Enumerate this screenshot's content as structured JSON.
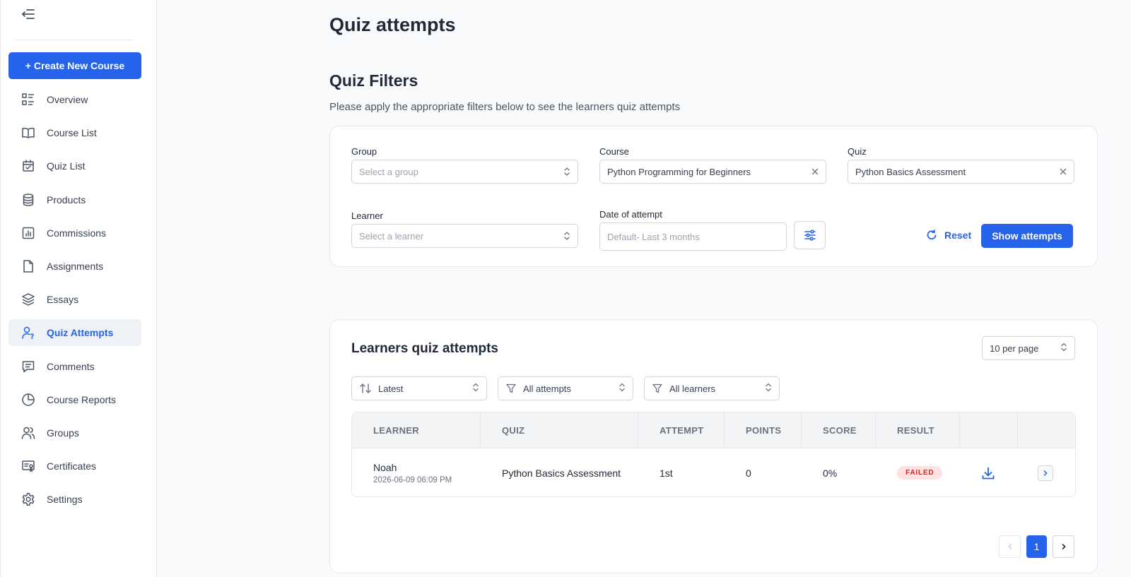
{
  "sidebar": {
    "create_label": "+ Create New Course",
    "items": [
      {
        "label": "Overview",
        "icon": "overview-icon",
        "active": false
      },
      {
        "label": "Course List",
        "icon": "book-icon",
        "active": false
      },
      {
        "label": "Quiz List",
        "icon": "calendar-check-icon",
        "active": false
      },
      {
        "label": "Products",
        "icon": "database-icon",
        "active": false
      },
      {
        "label": "Commissions",
        "icon": "bar-chart-icon",
        "active": false
      },
      {
        "label": "Assignments",
        "icon": "file-icon",
        "active": false
      },
      {
        "label": "Essays",
        "icon": "layers-icon",
        "active": false
      },
      {
        "label": "Quiz Attempts",
        "icon": "user-question-icon",
        "active": true
      },
      {
        "label": "Comments",
        "icon": "comment-icon",
        "active": false
      },
      {
        "label": "Course Reports",
        "icon": "pie-chart-icon",
        "active": false
      },
      {
        "label": "Groups",
        "icon": "users-icon",
        "active": false
      },
      {
        "label": "Certificates",
        "icon": "certificate-icon",
        "active": false
      },
      {
        "label": "Settings",
        "icon": "gear-icon",
        "active": false
      }
    ]
  },
  "page": {
    "title": "Quiz attempts"
  },
  "filters": {
    "title": "Quiz Filters",
    "subtitle": "Please apply the appropriate filters below to see the learners quiz attempts",
    "group_label": "Group",
    "group_placeholder": "Select a group",
    "course_label": "Course",
    "course_value": "Python Programming for Beginners",
    "quiz_label": "Quiz",
    "quiz_value": "Python Basics Assessment",
    "learner_label": "Learner",
    "learner_placeholder": "Select a learner",
    "date_label": "Date of attempt",
    "date_placeholder": "Default- Last 3 months",
    "reset_label": "Reset",
    "show_label": "Show attempts"
  },
  "results": {
    "title": "Learners quiz attempts",
    "per_page": "10 per page",
    "sort": "Latest",
    "attempt_filter": "All attempts",
    "learner_filter": "All learners",
    "columns": [
      "LEARNER",
      "QUIZ",
      "ATTEMPT",
      "POINTS",
      "SCORE",
      "RESULT"
    ],
    "rows": [
      {
        "learner": "Noah",
        "date": "2026-06-09 06:09 PM",
        "quiz": "Python Basics Assessment",
        "attempt": "1st",
        "points": "0",
        "score": "0%",
        "result": "FAILED"
      }
    ],
    "pagination": {
      "current": "1"
    }
  },
  "colors": {
    "accent": "#2563eb",
    "failed": "#dc2626",
    "failed_bg": "#fee2e2"
  }
}
